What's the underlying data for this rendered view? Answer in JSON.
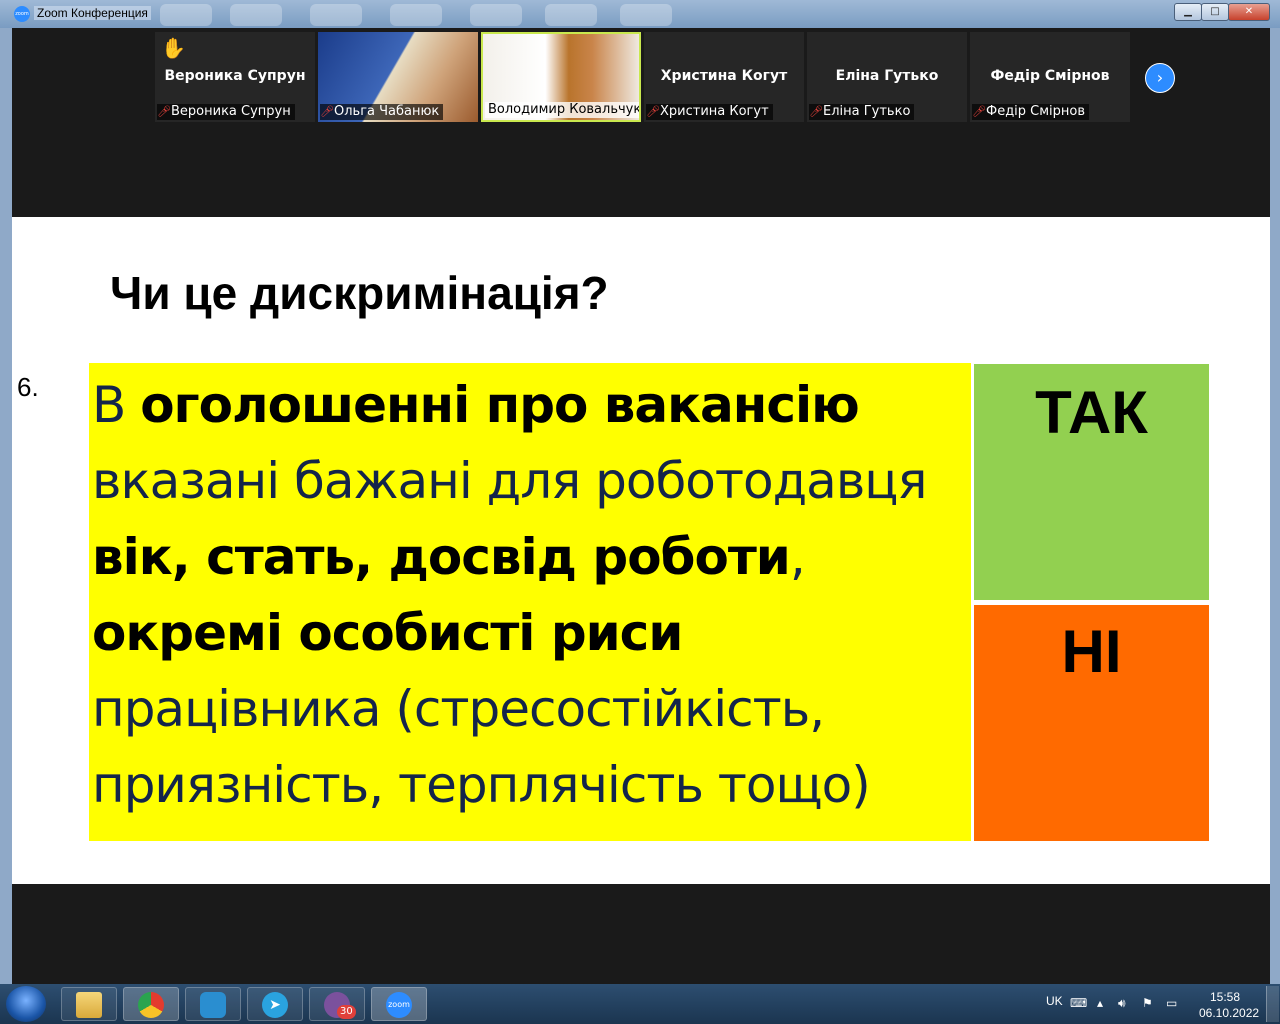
{
  "window": {
    "title": "Zoom Конференция",
    "controls": {
      "minimize": "▁",
      "maximize": "□",
      "close": "✕"
    }
  },
  "participants": [
    {
      "name": "Вероника Супрун",
      "label": "Вероника Супрун",
      "video": false,
      "hand_raised": true,
      "muted": true
    },
    {
      "name": "Ольга Чабанюк",
      "label": "Ольга Чабанюк",
      "video": true,
      "muted": true
    },
    {
      "name": "Володимир Ковальчук",
      "label": "Володимир Ковальчук",
      "video": true,
      "active_speaker": true,
      "muted": false
    },
    {
      "name": "Христина Когут",
      "label": "Христина Когут",
      "video": false,
      "muted": true
    },
    {
      "name": "Еліна Гутько",
      "label": "Еліна Гутько",
      "video": false,
      "muted": true
    },
    {
      "name": "Федір Смірнов",
      "label": "Федір Смірнов",
      "video": false,
      "muted": true
    }
  ],
  "slide": {
    "title": "Чи це дискримінація?",
    "number": "6.",
    "lines": [
      {
        "parts": [
          {
            "text": "В ",
            "bold": false
          },
          {
            "text": "оголошенні про вакансію",
            "bold": true
          }
        ]
      },
      {
        "parts": [
          {
            "text": "вказані бажані для роботодавця",
            "bold": false
          }
        ]
      },
      {
        "parts": [
          {
            "text": "вік, стать, досвід роботи",
            "bold": true
          },
          {
            "text": ",",
            "bold": false
          }
        ]
      },
      {
        "parts": [
          {
            "text": "окремі особисті риси",
            "bold": true
          }
        ]
      },
      {
        "parts": [
          {
            "text": "працівника (стресостійкість,",
            "bold": false
          }
        ]
      },
      {
        "parts": [
          {
            "text": "приязність, терплячість тощо)",
            "bold": false
          }
        ]
      }
    ],
    "answer_yes": "ТАК",
    "answer_no": "НІ",
    "colors": {
      "statement_bg": "#ffff00",
      "yes_bg": "#92d050",
      "no_bg": "#ff6a00"
    }
  },
  "taskbar": {
    "apps": [
      "explorer-icon",
      "chrome-icon",
      "video-app-icon",
      "telegram-icon",
      "viber-icon",
      "zoom-icon"
    ],
    "viber_badge": "30",
    "zoom_label": "zoom",
    "language": "UK",
    "time": "15:58",
    "date": "06.10.2022"
  }
}
